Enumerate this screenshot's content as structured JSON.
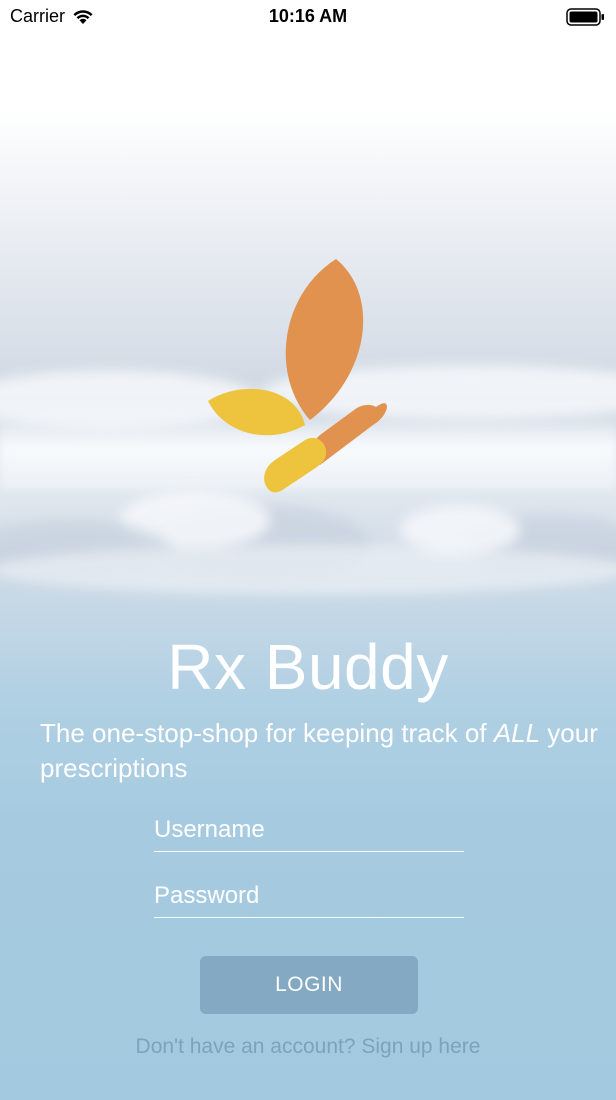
{
  "status_bar": {
    "carrier": "Carrier",
    "time": "10:16 AM",
    "wifi_icon": "wifi-icon",
    "battery_icon": "battery-icon"
  },
  "logo": {
    "icon": "butterfly-logo",
    "colors": {
      "orange": "#E0924E",
      "yellow": "#EEC43E"
    }
  },
  "app": {
    "title": "Rx Buddy",
    "tagline_before": "The one-stop-shop for keeping track of ",
    "tagline_emphasis": "ALL",
    "tagline_after": " your prescriptions"
  },
  "form": {
    "username_placeholder": "Username",
    "username_value": "",
    "password_placeholder": "Password",
    "password_value": "",
    "login_label": "LOGIN",
    "signup_text": "Don't have an account? Sign up here"
  },
  "colors": {
    "button_bg": "#84A9C2",
    "link": "#7EA2BB",
    "sky_bottom": "#A2C9DF"
  }
}
